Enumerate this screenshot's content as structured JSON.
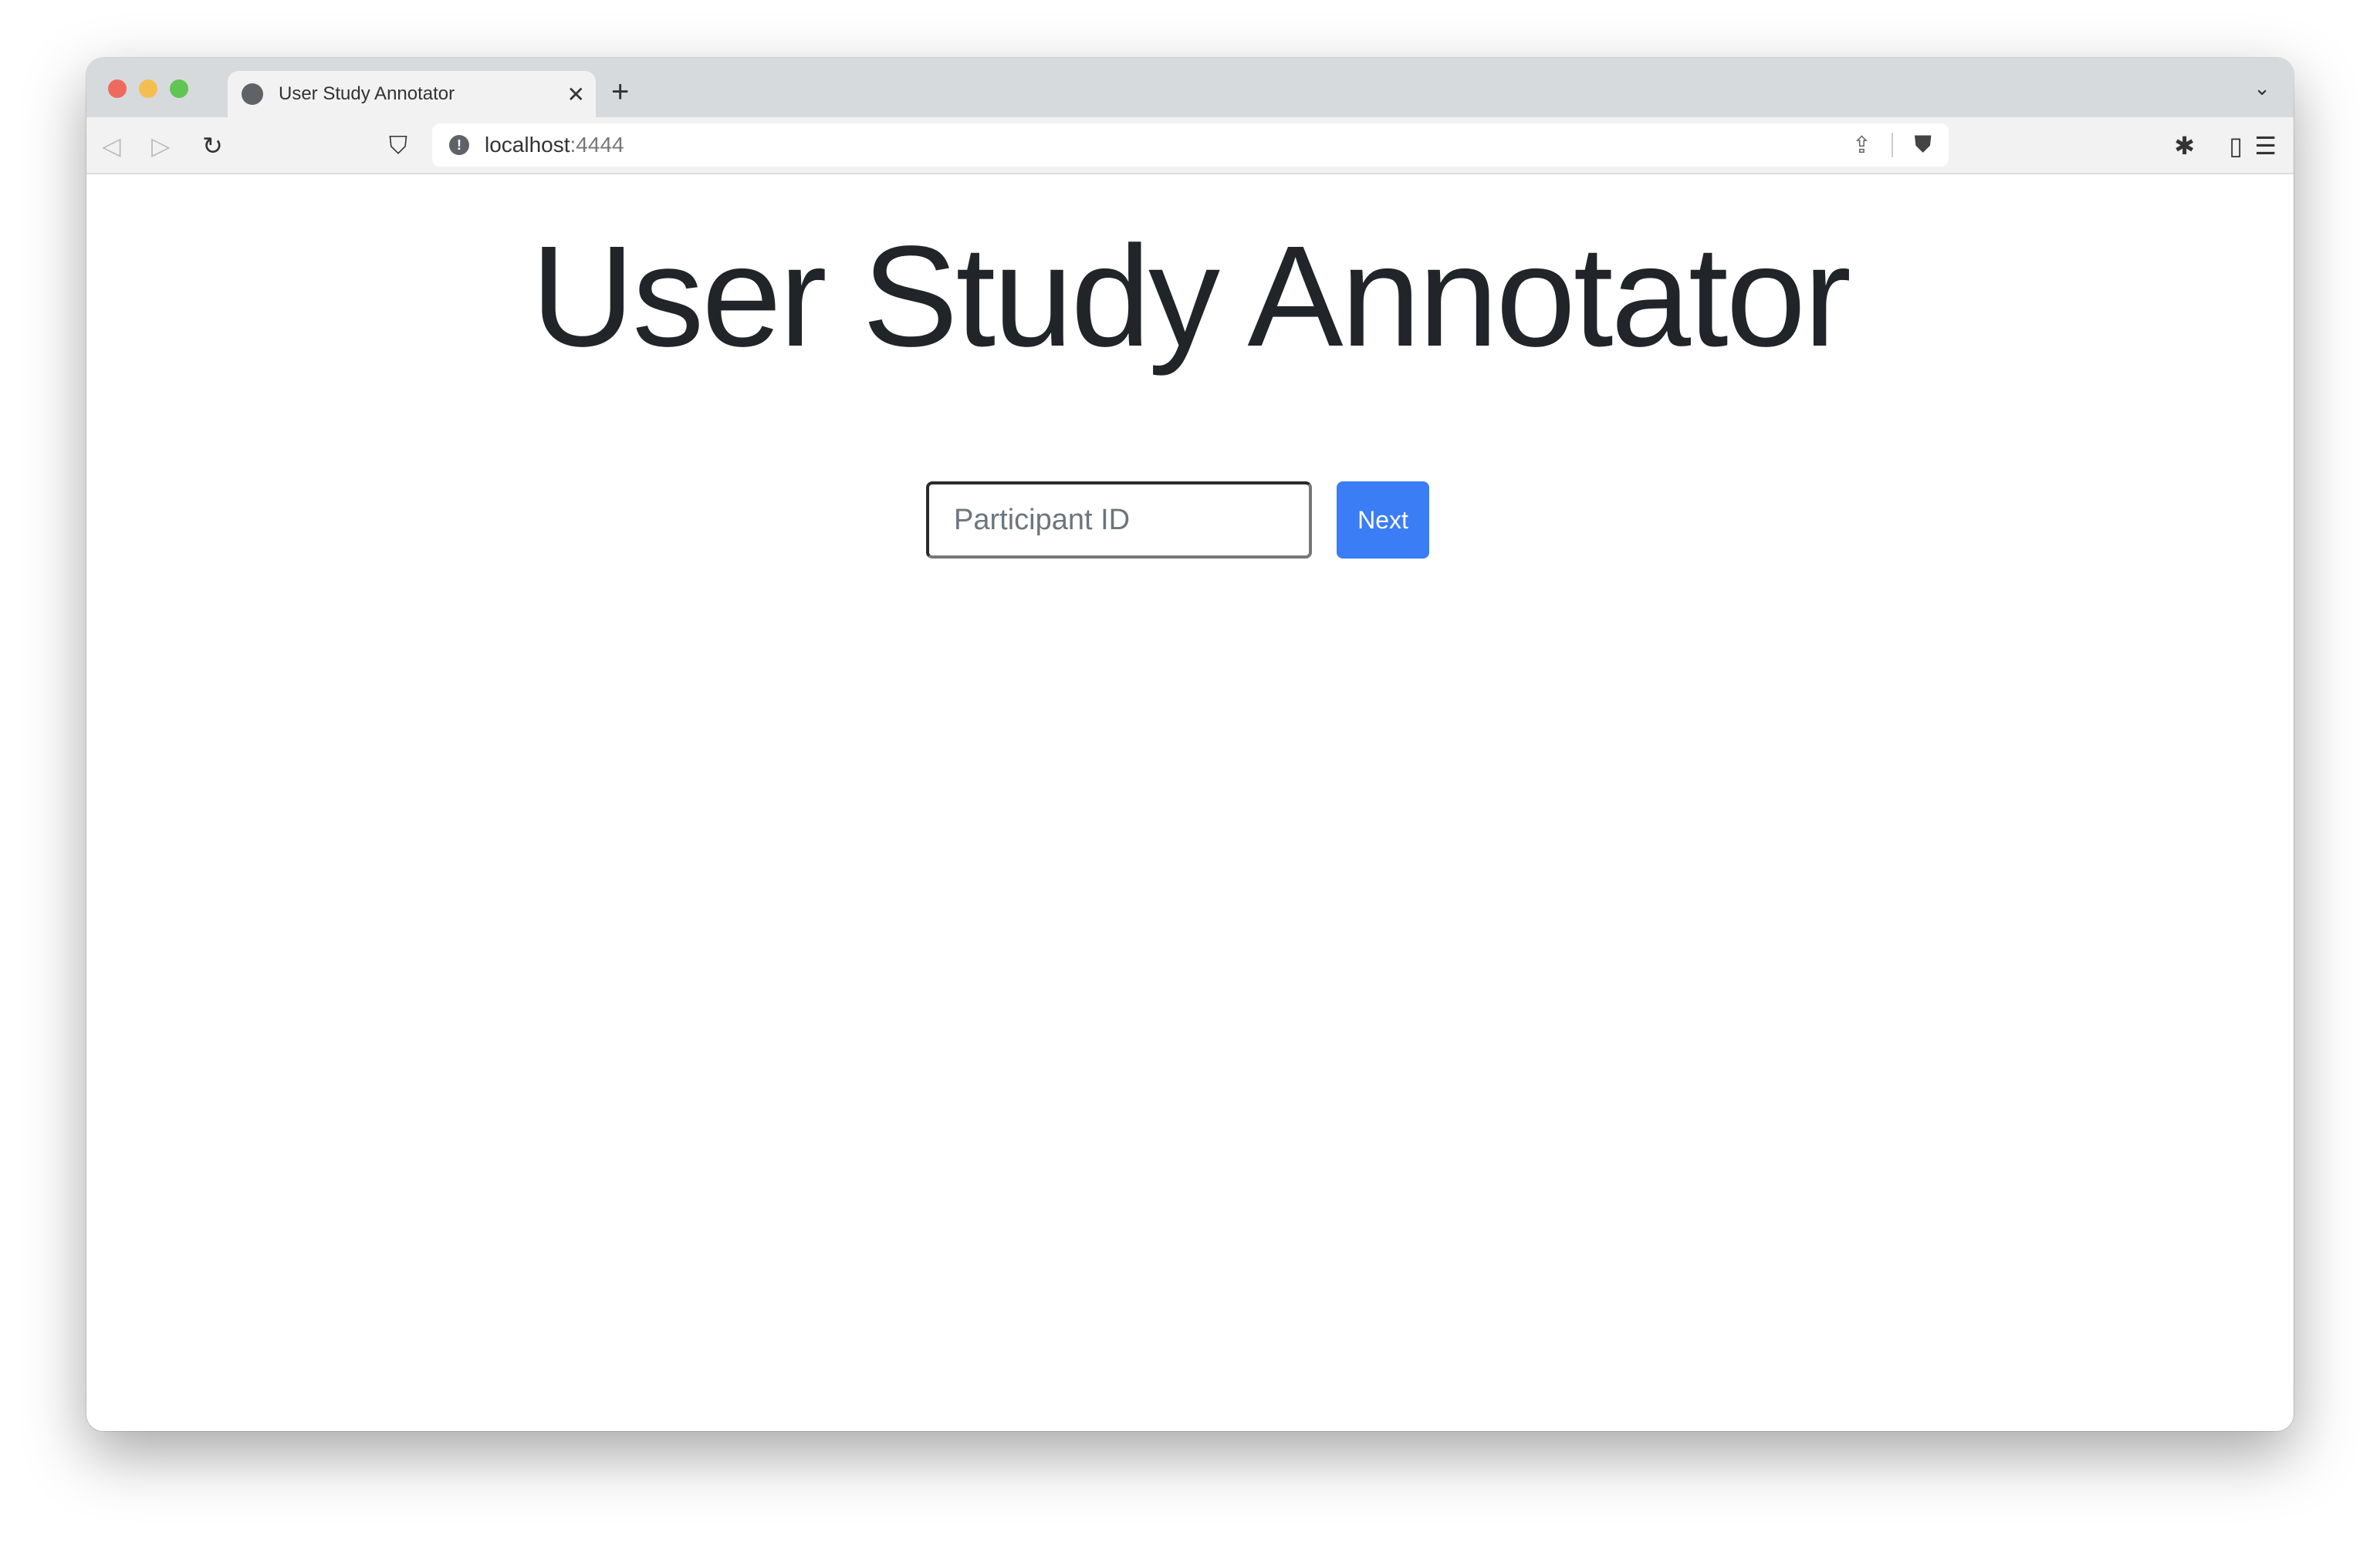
{
  "browser": {
    "tab_title": "User Study Annotator",
    "url_host": "localhost",
    "url_port": ":4444",
    "traffic_lights": {
      "close": "#ee6a5f",
      "minimize": "#f5bf4f",
      "maximize": "#61c554"
    }
  },
  "page": {
    "title": "User Study Annotator",
    "participant_input": {
      "placeholder": "Participant ID",
      "value": ""
    },
    "next_label": "Next",
    "accent": "#3a7df5"
  }
}
